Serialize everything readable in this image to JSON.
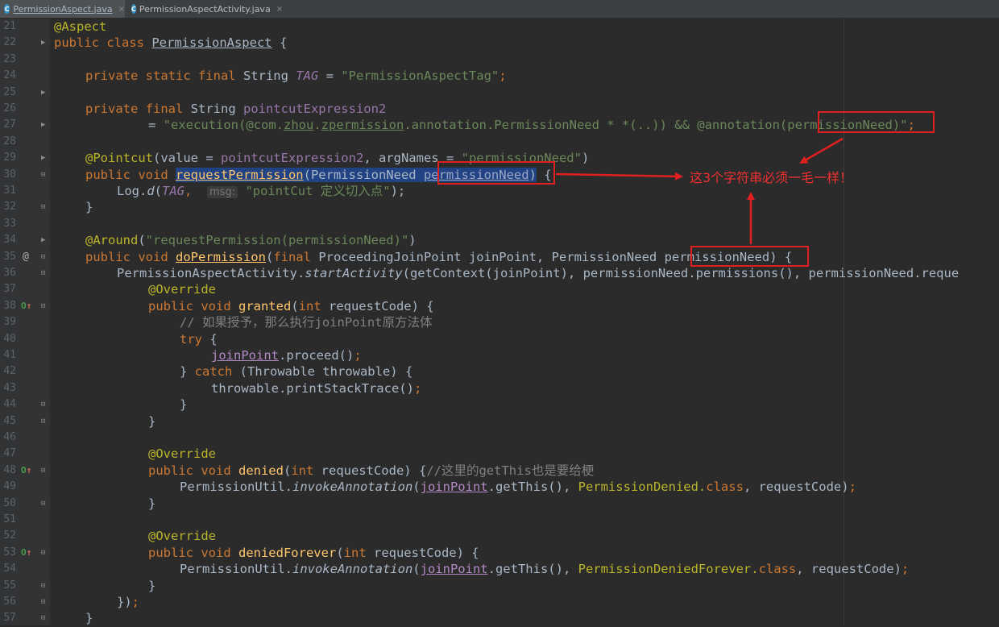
{
  "tabs": [
    {
      "label": "PermissionAspect.java",
      "icon": "class-c-icon",
      "active": true
    },
    {
      "label": "PermissionAspectActivity.java",
      "icon": "class-c-icon",
      "active": false
    }
  ],
  "tab_close_glyph": "×",
  "class_icon_letter": "C",
  "gutter": {
    "line_numbers": [
      "21",
      "22",
      "23",
      "24",
      "25",
      "26",
      "27",
      "28",
      "29",
      "30",
      "31",
      "32",
      "33",
      "34",
      "35",
      "36",
      "37",
      "38",
      "39",
      "40",
      "41",
      "42",
      "43",
      "44",
      "45",
      "46",
      "47",
      "48",
      "49",
      "50",
      "51",
      "52",
      "53",
      "54",
      "55",
      "56",
      "57"
    ],
    "at_marker": "@",
    "override_marker": "O",
    "override_arrow": "↑"
  },
  "code": {
    "l21": "@Aspect",
    "l22_kw": "public class ",
    "l22_name": "PermissionAspect",
    "l22_rest": " {",
    "l24_kw": "private static final ",
    "l24_type": "String ",
    "l24_const": "TAG",
    "l24_eq": " = ",
    "l24_str": "\"PermissionAspectTag\"",
    "l24_semi": ";",
    "l26_kw": "private final ",
    "l26_type": "String ",
    "l26_field": "pointcutExpression2",
    "l27_eq": "= ",
    "l27_s1": "\"execution(@com.",
    "l27_s2": "zhou",
    "l27_s3": ".",
    "l27_s4": "zpermission",
    "l27_s5": ".annotation.PermissionNeed * *(..)) && @annotation(",
    "l27_s6": "permissionNeed",
    "l27_s7": ")\"",
    "l27_semi": ";",
    "l29_ann": "@Pointcut",
    "l29_p1": "(value = ",
    "l29_field": "pointcutExpression2",
    "l29_p2": ", argNames = ",
    "l29_str": "\"permissionNeed\"",
    "l29_p3": ")",
    "l30_kw": "public void ",
    "l30_m": "requestPermission",
    "l30_p1": "(PermissionNeed ",
    "l30_param": "permissionNeed",
    "l30_p2": ")",
    "l30_p3": " {",
    "l31_a": "Log.",
    "l31_m": "d",
    "l31_b": "(",
    "l31_const": "TAG",
    "l31_c": ",  ",
    "l31_hint": "msg:",
    "l31_d": " ",
    "l31_str": "\"pointCut 定义切入点\"",
    "l31_e": ");",
    "l32": "}",
    "l34_ann": "@Around",
    "l34_p1": "(",
    "l34_str": "\"requestPermission(permissionNeed)\"",
    "l34_p2": ")",
    "l35_kw": "public void ",
    "l35_m": "doPermission",
    "l35_p1": "(",
    "l35_kw2": "final ",
    "l35_p2": "ProceedingJoinPoint joinPoint, PermissionNeed ",
    "l35_param": "permissionNeed",
    "l35_p3": ") {",
    "l36_a": "PermissionAspectActivity.",
    "l36_m": "startActivity",
    "l36_b": "(getContext(joinPoint), permissionNeed.permissions(), permissionNeed.reque",
    "l37": "@Override",
    "l38_kw": "public void ",
    "l38_m": "granted",
    "l38_p1": "(",
    "l38_kw2": "int ",
    "l38_p2": "requestCode) {",
    "l39": "// 如果授予，那么执行joinPoint原方法体",
    "l40_kw": "try ",
    "l40_p": "{",
    "l41_v": "joinPoint",
    "l41_p": ".proceed()",
    "l41_semi": ";",
    "l42_a": "} ",
    "l42_kw": "catch ",
    "l42_p": "(Throwable throwable) {",
    "l43_p": "throwable.printStackTrace()",
    "l43_semi": ";",
    "l44": "}",
    "l45": "}",
    "l47": "@Override",
    "l48_kw": "public void ",
    "l48_m": "denied",
    "l48_p1": "(",
    "l48_kw2": "int ",
    "l48_p2": "requestCode) {",
    "l48_cm": "//这里的getThis也是要给梗",
    "l49_a": "PermissionUtil.",
    "l49_m": "invokeAnnotation",
    "l49_b": "(",
    "l49_v": "joinPoint",
    "l49_c": ".getThis(), ",
    "l49_cls": "PermissionDenied.",
    "l49_kw": "class",
    "l49_d": ", requestCode)",
    "l49_semi": ";",
    "l50": "}",
    "l52": "@Override",
    "l53_kw": "public void ",
    "l53_m": "deniedForever",
    "l53_p1": "(",
    "l53_kw2": "int ",
    "l53_p2": "requestCode) {",
    "l54_a": "PermissionUtil.",
    "l54_m": "invokeAnnotation",
    "l54_b": "(",
    "l54_v": "joinPoint",
    "l54_c": ".getThis(), ",
    "l54_cls": "PermissionDeniedForever.",
    "l54_kw": "class",
    "l54_d": ", requestCode)",
    "l54_semi": ";",
    "l55": "}",
    "l56_a": "})",
    "l56_semi": ";",
    "l57": "}"
  },
  "annotation_note": "这3个字符串必须一毛一样！",
  "colors": {
    "editor_bg": "#2B2B2B",
    "keyword": "#CC7832",
    "string": "#6A8759",
    "annotation": "#BBB529",
    "method": "#FFC66D",
    "field": "#9876AA",
    "selection": "#214283",
    "callout_red": "#E02020"
  }
}
